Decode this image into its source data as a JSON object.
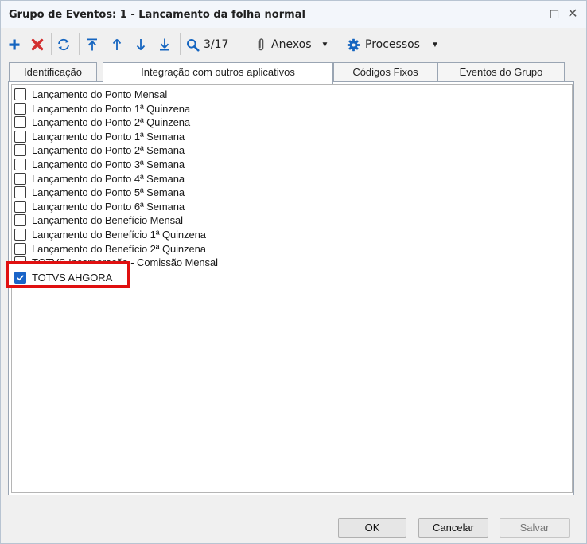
{
  "window": {
    "title": "Grupo de Eventos: 1 - Lancamento da folha normal",
    "maximize_glyph": "☐",
    "close_glyph": "✕"
  },
  "toolbar": {
    "record_position": "3/17",
    "anexos_label": "Anexos",
    "processos_label": "Processos",
    "icons": [
      "plus-icon",
      "delete-x-icon",
      "refresh-icon",
      "first-record-icon",
      "previous-record-icon",
      "next-record-icon",
      "last-record-icon",
      "search-icon",
      "paperclip-icon",
      "gear-icon"
    ],
    "colors": {
      "add": "#1565c0",
      "delete": "#d32f2f",
      "nav": "#1565c0"
    }
  },
  "tabs": [
    {
      "label": "Identificação",
      "active": false
    },
    {
      "label": "Integração com outros aplicativos",
      "active": true
    },
    {
      "label": "Códigos Fixos",
      "active": false
    },
    {
      "label": "Eventos do Grupo",
      "active": false
    }
  ],
  "items": [
    {
      "label": "Lançamento do Ponto Mensal",
      "checked": false
    },
    {
      "label": "Lançamento do Ponto 1ª Quinzena",
      "checked": false
    },
    {
      "label": "Lançamento do Ponto 2ª Quinzena",
      "checked": false
    },
    {
      "label": "Lançamento do Ponto 1ª Semana",
      "checked": false
    },
    {
      "label": "Lançamento do Ponto 2ª Semana",
      "checked": false
    },
    {
      "label": "Lançamento do Ponto 3ª Semana",
      "checked": false
    },
    {
      "label": "Lançamento do Ponto 4ª Semana",
      "checked": false
    },
    {
      "label": "Lançamento do Ponto 5ª Semana",
      "checked": false
    },
    {
      "label": "Lançamento do Ponto 6ª Semana",
      "checked": false
    },
    {
      "label": "Lançamento do Benefício Mensal",
      "checked": false
    },
    {
      "label": "Lançamento do Benefício 1ª Quinzena",
      "checked": false
    },
    {
      "label": "Lançamento do Benefício 2ª Quinzena",
      "checked": false
    },
    {
      "label": "TOTVS Incorporação - Comissão Mensal",
      "checked": false
    },
    {
      "label": "TOTVS AHGORA",
      "checked": true
    }
  ],
  "highlight_color": "#e01010",
  "footer": {
    "ok_label": "OK",
    "cancel_label": "Cancelar",
    "save_label": "Salvar",
    "save_disabled": true
  }
}
